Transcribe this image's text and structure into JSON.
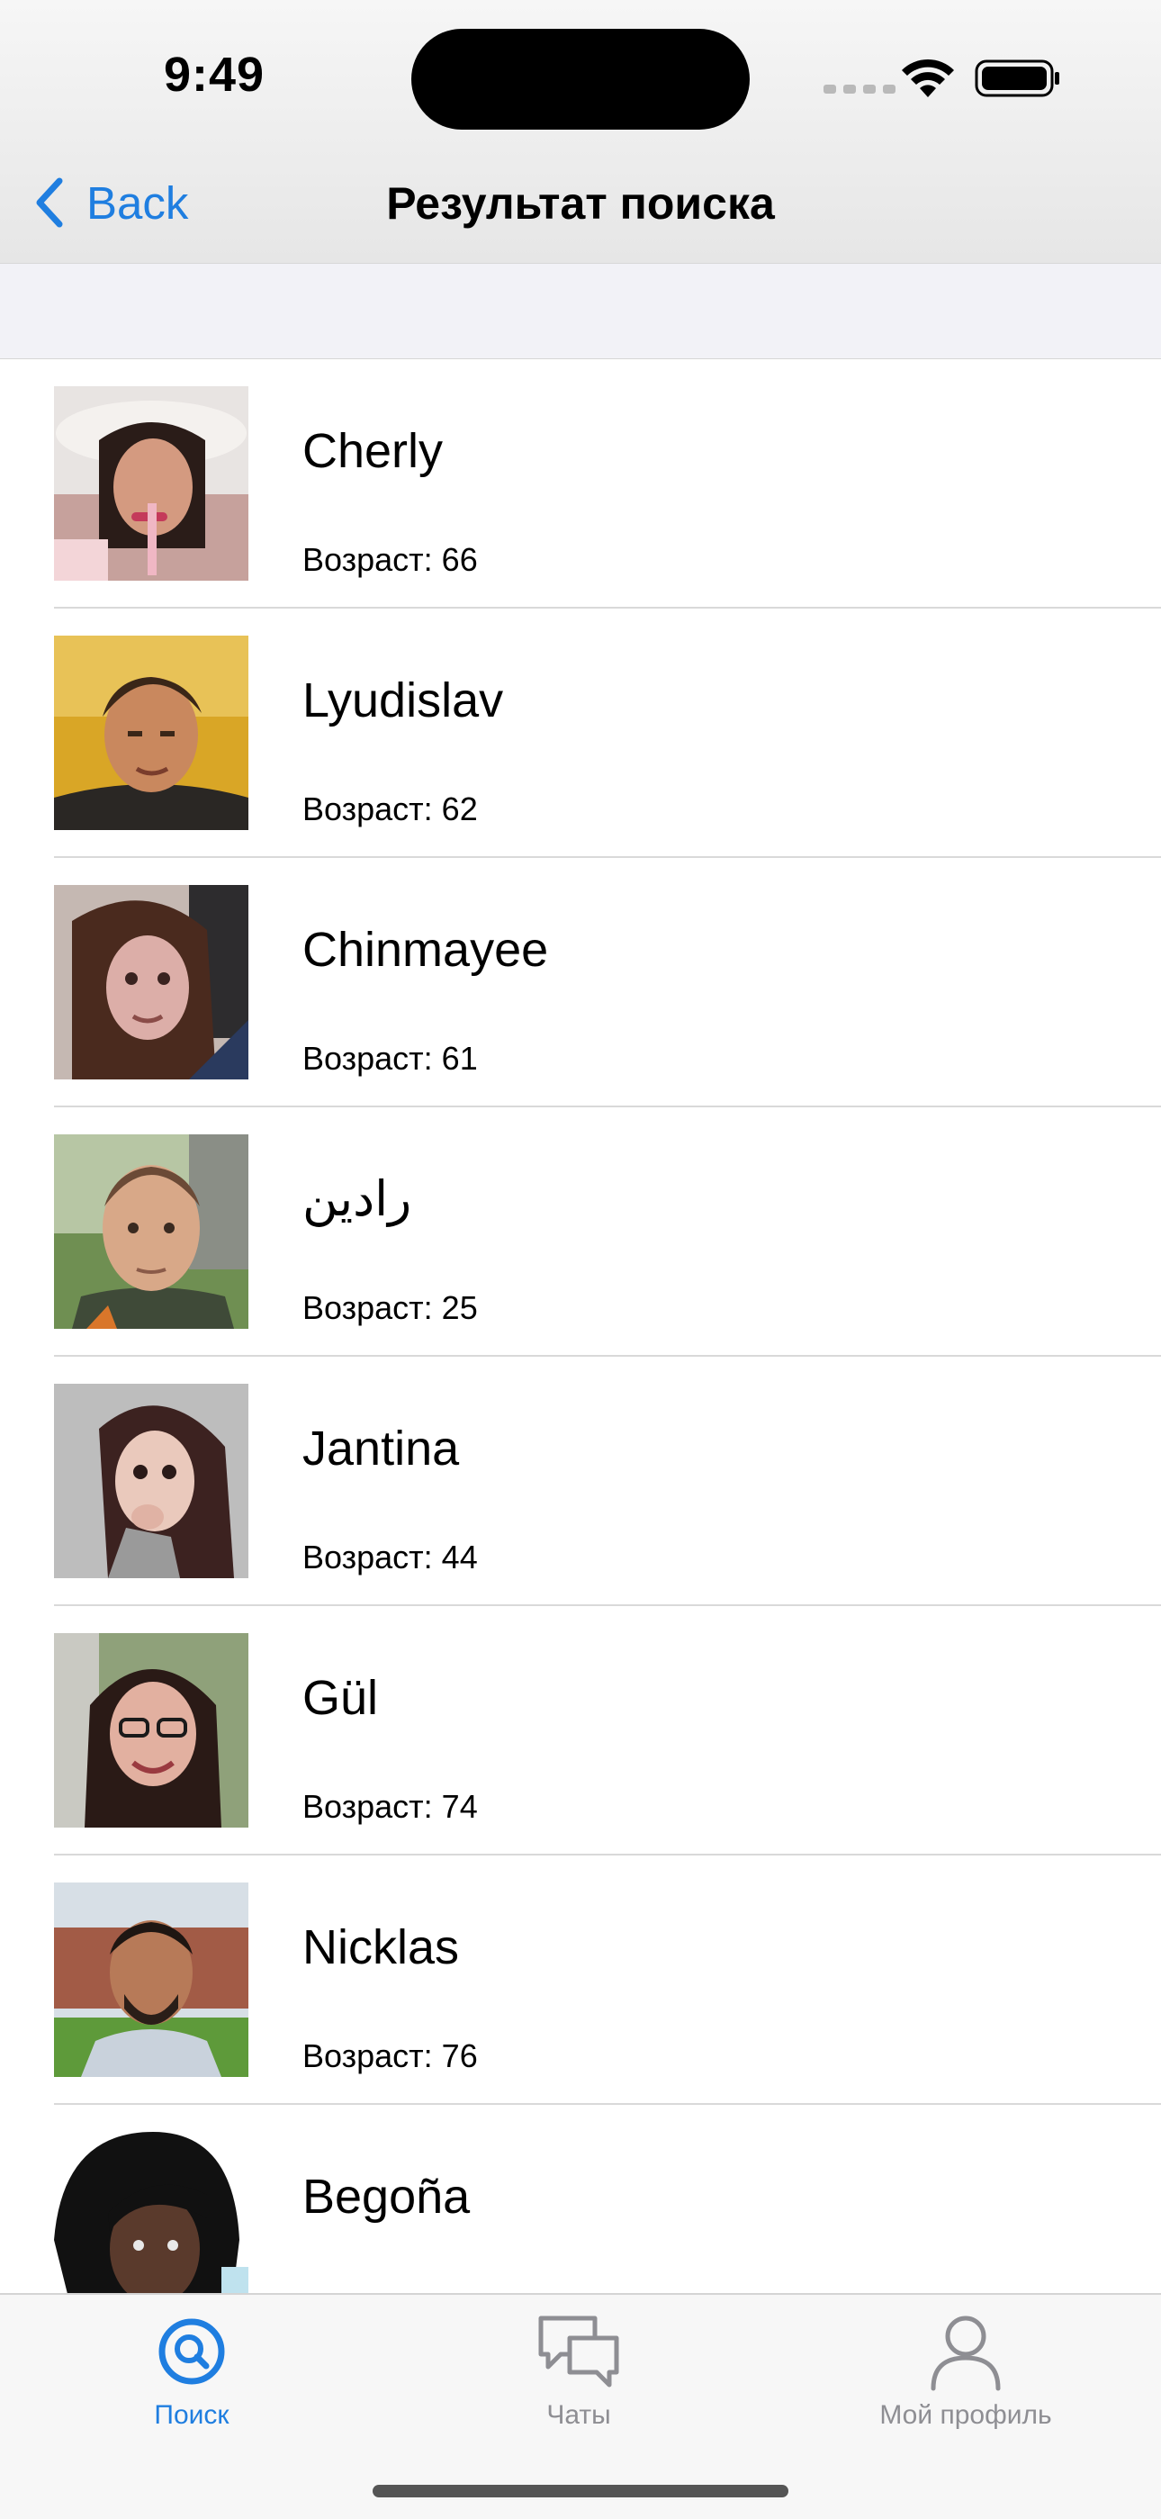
{
  "status_bar": {
    "time": "9:49",
    "icons": [
      "cellular-signal-icon",
      "wifi-icon",
      "battery-icon"
    ]
  },
  "nav_bar": {
    "back_label": "Back",
    "title": "Результат поиска"
  },
  "colors": {
    "accent": "#1f7ee0",
    "inactive_tab": "#8e8e93",
    "section_background": "#f2f2f7"
  },
  "results": [
    {
      "name": "Cherly",
      "age": "Возраст: 66"
    },
    {
      "name": "Lyudislav",
      "age": "Возраст: 62"
    },
    {
      "name": "Chinmayee",
      "age": "Возраст: 61"
    },
    {
      "name": "رادين",
      "age": "Возраст: 25"
    },
    {
      "name": "Jantina",
      "age": "Возраст: 44"
    },
    {
      "name": "Gül",
      "age": "Возраст: 74"
    },
    {
      "name": "Nicklas",
      "age": "Возраст: 76"
    },
    {
      "name": "Begoña",
      "age": ""
    }
  ],
  "tab_bar": {
    "tabs": [
      {
        "label": "Поиск",
        "icon": "search-icon",
        "active": true
      },
      {
        "label": "Чаты",
        "icon": "chat-bubbles-icon",
        "active": false
      },
      {
        "label": "Мой профиль",
        "icon": "person-icon",
        "active": false
      }
    ]
  }
}
